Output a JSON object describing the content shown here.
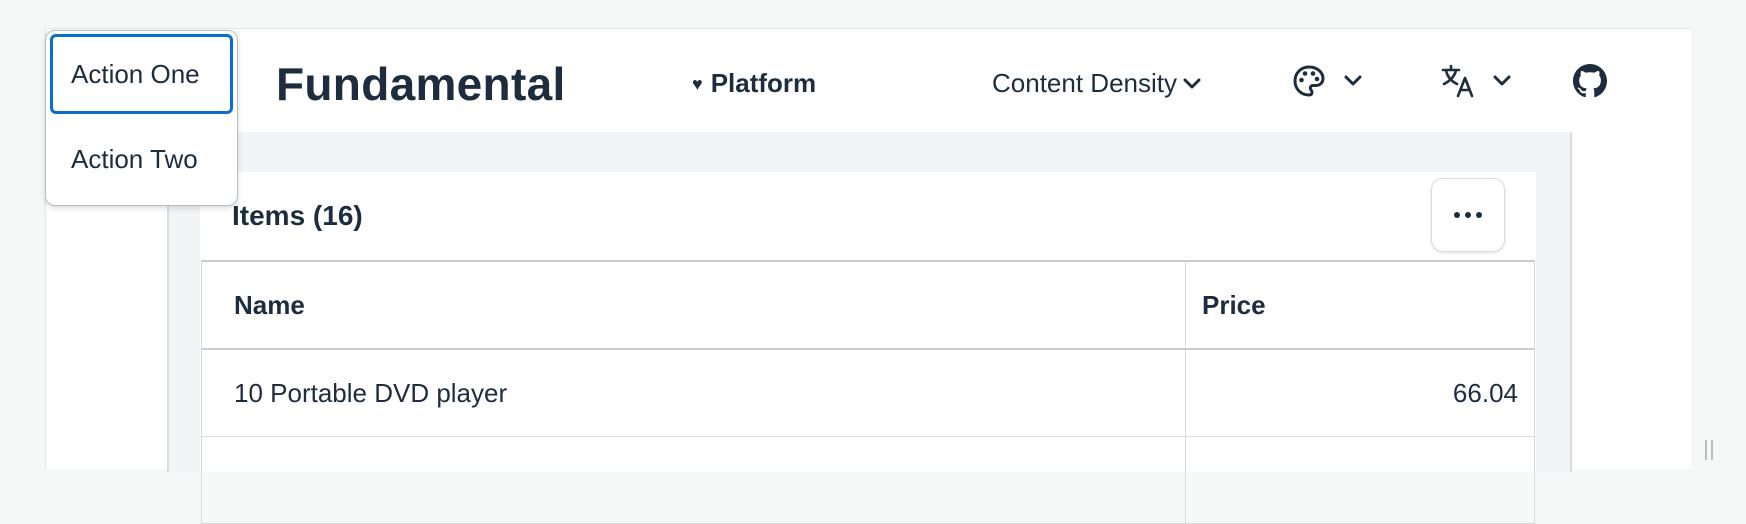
{
  "header": {
    "brand": "Fundamental",
    "platform_label": "Platform",
    "density_label": "Content Density",
    "theme_icon": "palette-icon",
    "language_icon": "translate-icon",
    "github_icon": "github-icon"
  },
  "menu": {
    "items": [
      {
        "label": "Action One",
        "focused": true
      },
      {
        "label": "Action Two",
        "focused": false
      }
    ]
  },
  "card": {
    "title": "Items (16)",
    "overflow_icon": "more-horizontal-icon"
  },
  "table": {
    "columns": [
      "Name",
      "Price"
    ],
    "rows": [
      {
        "name": "10 Portable DVD player",
        "price": "66.04"
      }
    ]
  },
  "colors": {
    "text": "#1d2d3e",
    "focus": "#0a6ed1",
    "background": "#f6f7f7",
    "panel": "#f3f4f5"
  }
}
